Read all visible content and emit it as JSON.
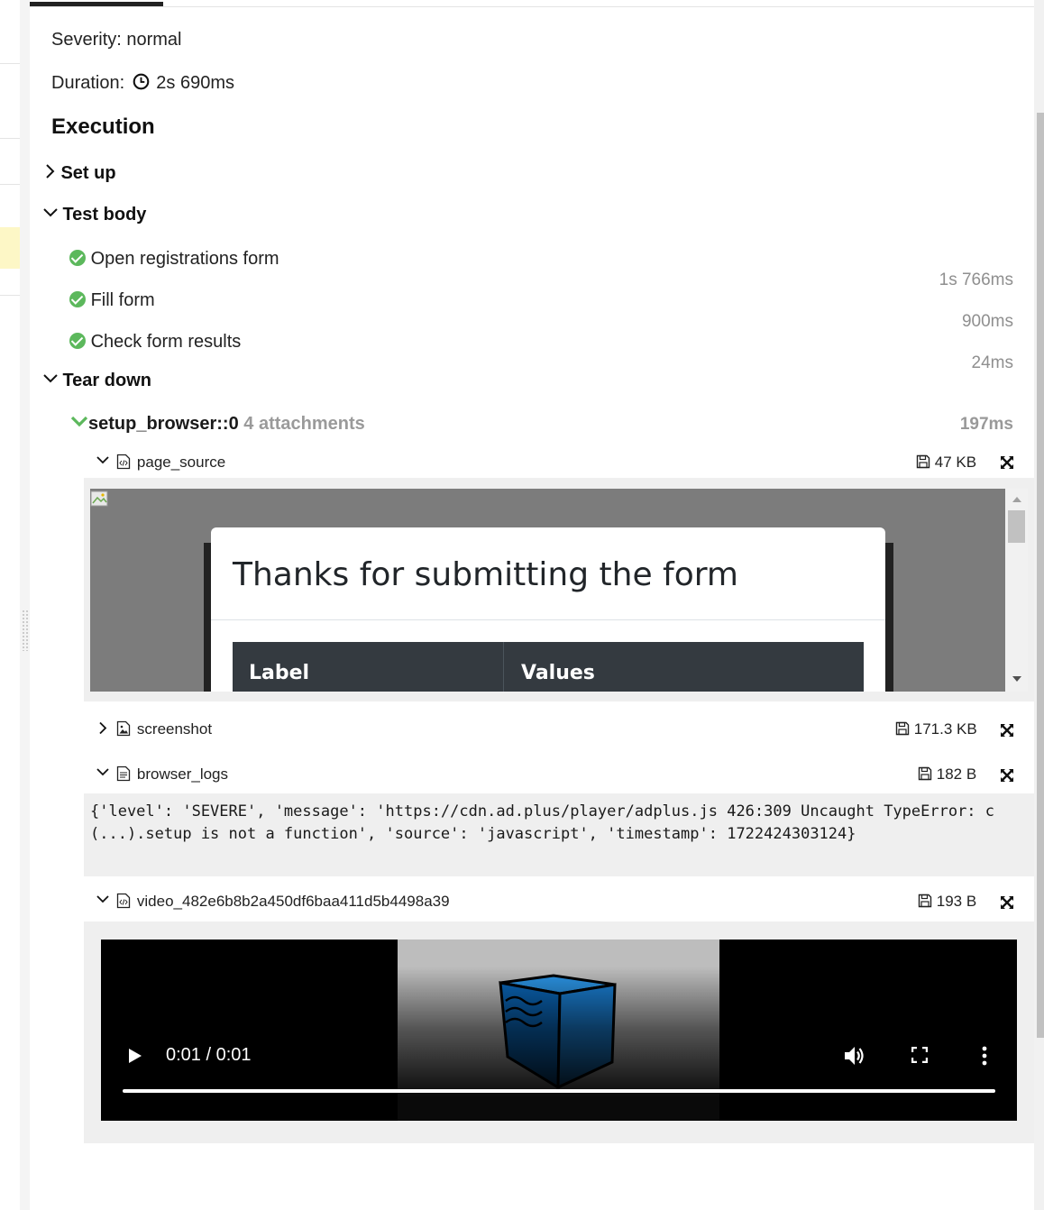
{
  "test": {
    "severity_text": "Severity: normal",
    "duration_label": "Duration:",
    "duration_value": "2s 690ms",
    "execution_title": "Execution"
  },
  "groups": {
    "setup": "Set up",
    "body": "Test body",
    "teardown": "Tear down"
  },
  "steps": [
    {
      "name": "Open registrations form",
      "duration": "1s 766ms",
      "status": "passed"
    },
    {
      "name": "Fill form",
      "duration": "900ms",
      "status": "passed"
    },
    {
      "name": "Check form results",
      "duration": "24ms",
      "status": "passed"
    }
  ],
  "fixture": {
    "name": "setup_browser::0",
    "attachments_label": "4 attachments",
    "duration": "197ms"
  },
  "attachments": [
    {
      "name": "page_source",
      "size": "47 KB",
      "icon": "code-file-icon",
      "expanded": true
    },
    {
      "name": "screenshot",
      "size": "171.3 KB",
      "icon": "image-file-icon",
      "expanded": false
    },
    {
      "name": "browser_logs",
      "size": "182 B",
      "icon": "text-file-icon",
      "expanded": true
    },
    {
      "name": "video_482e6b8b2a450df6baa411d5b4498a39",
      "size": "193 B",
      "icon": "code-file-icon",
      "expanded": true
    }
  ],
  "page_source_preview": {
    "modal_title": "Thanks for submitting the form",
    "col1": "Label",
    "col2": "Values"
  },
  "browser_log_text": "{'level': 'SEVERE', 'message': 'https://cdn.ad.plus/player/adplus.js 426:309 Uncaught TypeError: c(...).setup is not a function', 'source': 'javascript', 'timestamp': 1722424303124}",
  "video": {
    "time": "0:01 / 0:01",
    "progress": 1.0
  },
  "colors": {
    "passed": "#5cb85c",
    "video_cube": "#1a7fd4"
  }
}
